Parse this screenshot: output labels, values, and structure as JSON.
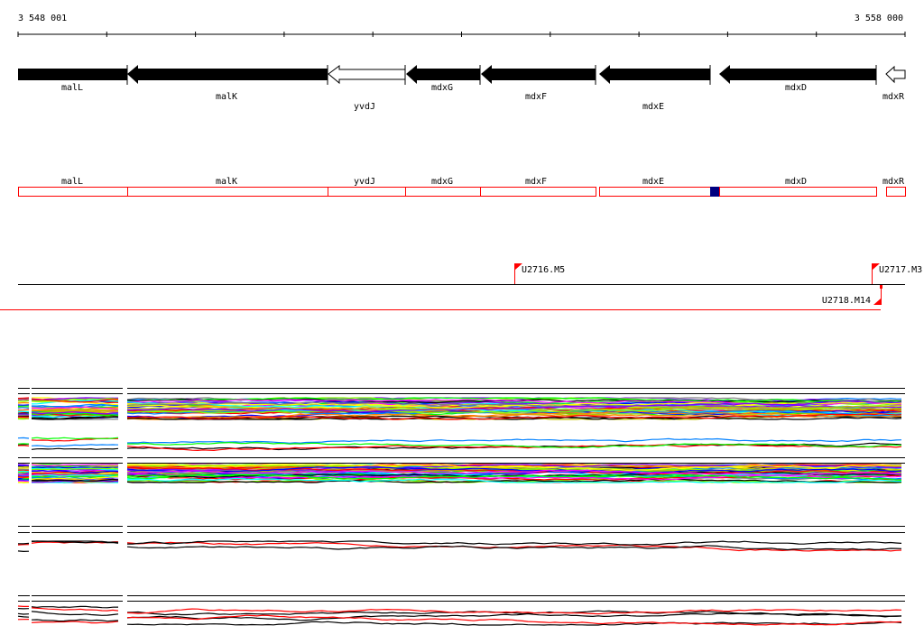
{
  "ruler": {
    "start_label": "3 548 001",
    "end_label": "3 558 000",
    "tick_count": 10
  },
  "genes": [
    {
      "name": "malL",
      "strand": "-",
      "filled": true
    },
    {
      "name": "malK",
      "strand": "-",
      "filled": true
    },
    {
      "name": "yvdJ",
      "strand": "-",
      "filled": false
    },
    {
      "name": "mdxG",
      "strand": "-",
      "filled": true
    },
    {
      "name": "mdxF",
      "strand": "-",
      "filled": true
    },
    {
      "name": "mdxE",
      "strand": "-",
      "filled": true
    },
    {
      "name": "mdxD",
      "strand": "-",
      "filled": true
    },
    {
      "name": "mdxR",
      "strand": "-",
      "filled": false
    }
  ],
  "markers": [
    {
      "label": "U2716.M5"
    },
    {
      "label": "U2717.M3"
    },
    {
      "label": "U2718.M14"
    }
  ],
  "colors": {
    "gene_box_border": "#ff0000",
    "highlight": "#000080",
    "marker": "#ff0000",
    "trace_palette": [
      "#ff0000",
      "#00ff00",
      "#0000ff",
      "#ff00ff",
      "#00ffff",
      "#ffff00",
      "#ff8000",
      "#808080",
      "#0080ff",
      "#80ff00",
      "#c0c000",
      "#8000ff",
      "#000000"
    ]
  }
}
